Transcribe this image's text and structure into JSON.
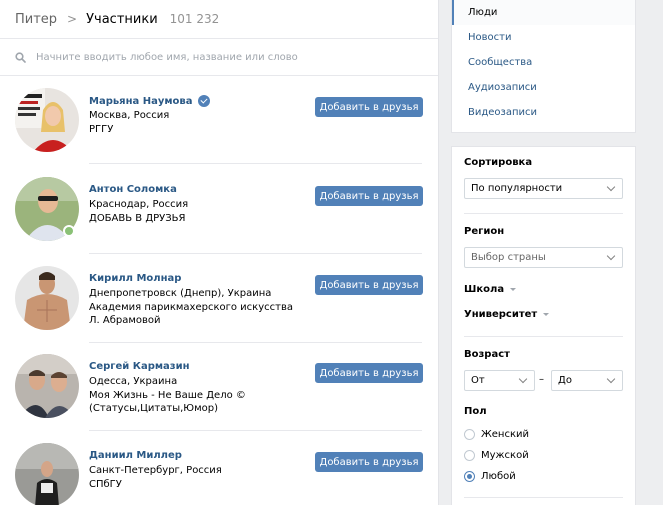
{
  "breadcrumb": {
    "parent": "Питер",
    "separator": ">",
    "current": "Участники",
    "count": "101 232"
  },
  "search": {
    "placeholder": "Начните вводить любое имя, название или слово"
  },
  "people": [
    {
      "name": "Марьяна Наумова",
      "verified": true,
      "online": false,
      "lines": [
        "Москва, Россия",
        "РГГУ"
      ],
      "button": "Добавить в друзья"
    },
    {
      "name": "Антон Соломка",
      "verified": false,
      "online": true,
      "lines": [
        "Краснодар, Россия",
        "ДОБАВЬ В ДРУЗЬЯ"
      ],
      "button": "Добавить в друзья"
    },
    {
      "name": "Кирилл Молнар",
      "verified": false,
      "online": false,
      "lines": [
        "Днепропетровск (Днепр), Украина",
        "Академия парикмахерского искусства Л. Абрамовой"
      ],
      "button": "Добавить в друзья"
    },
    {
      "name": "Сергей Кармазин",
      "verified": false,
      "online": false,
      "lines": [
        "Одесса, Украина",
        "Моя Жизнь - Не Ваше Дело © (Статусы,Цитаты,Юмор)"
      ],
      "button": "Добавить в друзья"
    },
    {
      "name": "Даниил Миллер",
      "verified": false,
      "online": false,
      "lines": [
        "Санкт-Петербург, Россия",
        "СПбГУ"
      ],
      "button": "Добавить в друзья"
    }
  ],
  "nav": {
    "items": [
      "Люди",
      "Новости",
      "Сообщества",
      "Аудиозаписи",
      "Видеозаписи"
    ],
    "active": "Люди"
  },
  "filters": {
    "sort": {
      "title": "Сортировка",
      "value": "По популярности"
    },
    "region": {
      "title": "Регион",
      "value": "Выбор страны"
    },
    "school": {
      "title": "Школа"
    },
    "university": {
      "title": "Университет"
    },
    "age": {
      "title": "Возраст",
      "from": "От",
      "dash": "–",
      "to": "До"
    },
    "gender": {
      "title": "Пол",
      "options": [
        "Женский",
        "Мужской",
        "Любой"
      ],
      "selected": "Любой"
    }
  },
  "colors": {
    "accent": "#5181b8",
    "link": "#2a5885",
    "online": "#8ac176",
    "background": "#edeef0"
  }
}
